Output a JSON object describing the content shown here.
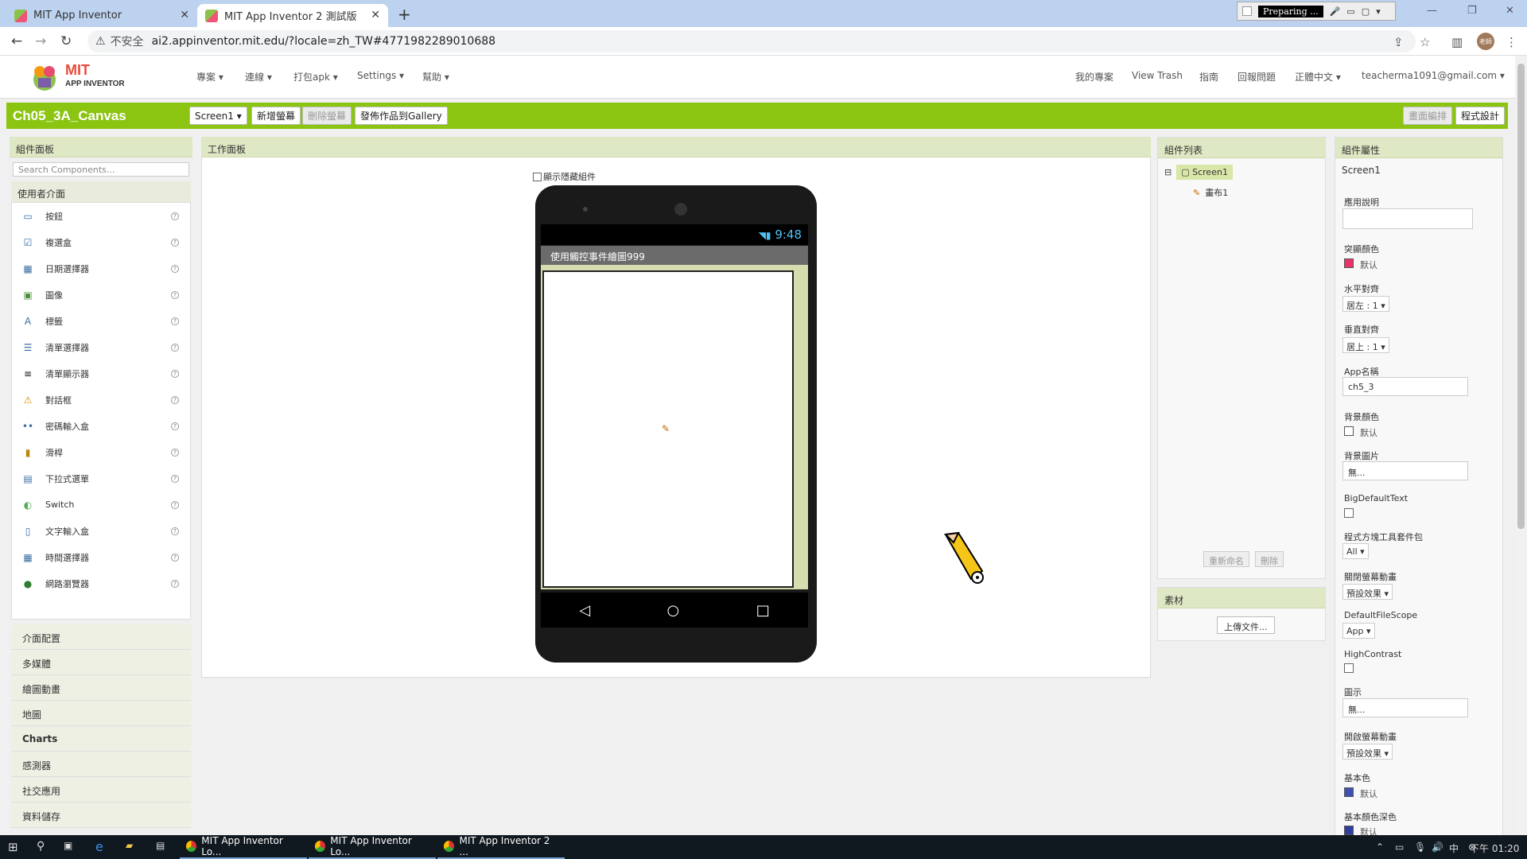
{
  "browser": {
    "tabs": [
      {
        "title": "MIT App Inventor",
        "active": false
      },
      {
        "title": "MIT App Inventor 2 測試版",
        "active": true
      }
    ],
    "new_tab": "+",
    "media_indicator": "Preparing ...",
    "url_warning": "不安全",
    "url": "ai2.appinventor.mit.edu/?locale=zh_TW#4771982289010688",
    "profile_label": "老師"
  },
  "appbar": {
    "logo_top": "MIT",
    "logo_bottom": "APP INVENTOR",
    "menu_left": [
      "專案",
      "連線",
      "打包apk",
      "Settings",
      "幫助"
    ],
    "menu_right": [
      "我的專案",
      "View Trash",
      "指南",
      "回報問題",
      "正體中文",
      "teacherma1091@gmail.com"
    ]
  },
  "toolbar": {
    "project_name": "Ch05_3A_Canvas",
    "screen_select": "Screen1",
    "add_screen": "新增螢幕",
    "remove_screen": "刪除螢幕",
    "publish_gallery": "發佈作品到Gallery",
    "designer": "畫面編排",
    "blocks": "程式設計"
  },
  "palette": {
    "title": "組件面板",
    "search_placeholder": "Search Components...",
    "ui_header": "使用者介面",
    "items": [
      {
        "label": "按鈕",
        "icon": "button-icon"
      },
      {
        "label": "複選盒",
        "icon": "checkbox-icon"
      },
      {
        "label": "日期選擇器",
        "icon": "datepicker-icon"
      },
      {
        "label": "圖像",
        "icon": "image-icon"
      },
      {
        "label": "標籤",
        "icon": "label-icon"
      },
      {
        "label": "清單選擇器",
        "icon": "listpicker-icon"
      },
      {
        "label": "清單顯示器",
        "icon": "listview-icon"
      },
      {
        "label": "對話框",
        "icon": "notifier-icon"
      },
      {
        "label": "密碼輸入盒",
        "icon": "password-icon"
      },
      {
        "label": "滑桿",
        "icon": "slider-icon"
      },
      {
        "label": "下拉式選單",
        "icon": "spinner-icon"
      },
      {
        "label": "Switch",
        "icon": "switch-icon"
      },
      {
        "label": "文字輸入盒",
        "icon": "textbox-icon"
      },
      {
        "label": "時間選擇器",
        "icon": "timepicker-icon"
      },
      {
        "label": "網路瀏覽器",
        "icon": "webviewer-icon"
      }
    ],
    "help_glyph": "?",
    "categories": [
      "介面配置",
      "多媒體",
      "繪圖動畫",
      "地圖",
      "Charts",
      "感測器",
      "社交應用",
      "資料儲存"
    ]
  },
  "viewer": {
    "title": "工作面板",
    "show_hidden": "顯示隱藏組件",
    "time": "9:48",
    "app_title": "使用觸控事件繪圖999"
  },
  "components": {
    "title": "組件列表",
    "tree": [
      "Screen1",
      "畫布1"
    ],
    "rename": "重新命名",
    "delete": "刪除",
    "media_title": "素材",
    "upload": "上傳文件..."
  },
  "properties": {
    "title": "組件屬性",
    "component": "Screen1",
    "about_label": "應用說明",
    "accent_label": "突顯顏色",
    "accent_value": "默认",
    "accent_color": "#e8336b",
    "halign_label": "水平對齊",
    "halign_value": "居左 : 1",
    "valign_label": "垂直對齊",
    "valign_value": "居上 : 1",
    "appname_label": "App名稱",
    "appname_value": "ch5_3",
    "bgcolor_label": "背景顏色",
    "bgcolor_value": "默认",
    "bgimage_label": "背景圖片",
    "bgimage_value": "無...",
    "bigtext_label": "BigDefaultText",
    "blocks_toolkit_label": "程式方塊工具套件包",
    "blocks_toolkit_value": "All",
    "close_anim_label": "關閉螢幕動畫",
    "close_anim_value": "預設效果",
    "filescope_label": "DefaultFileScope",
    "filescope_value": "App",
    "highcontrast_label": "HighContrast",
    "icon_label": "圖示",
    "icon_value": "無...",
    "open_anim_label": "開啟螢幕動畫",
    "open_anim_value": "預設效果",
    "primary_label": "基本色",
    "primary_value": "默认",
    "primary_color": "#3f51b5",
    "primary_dark_label": "基本顏色深色",
    "primary_dark_value": "默认"
  },
  "taskbar": {
    "apps": [
      "MIT App Inventor Lo...",
      "MIT App Inventor Lo...",
      "MIT App Inventor 2 ..."
    ],
    "clock": "下午 01:20"
  }
}
